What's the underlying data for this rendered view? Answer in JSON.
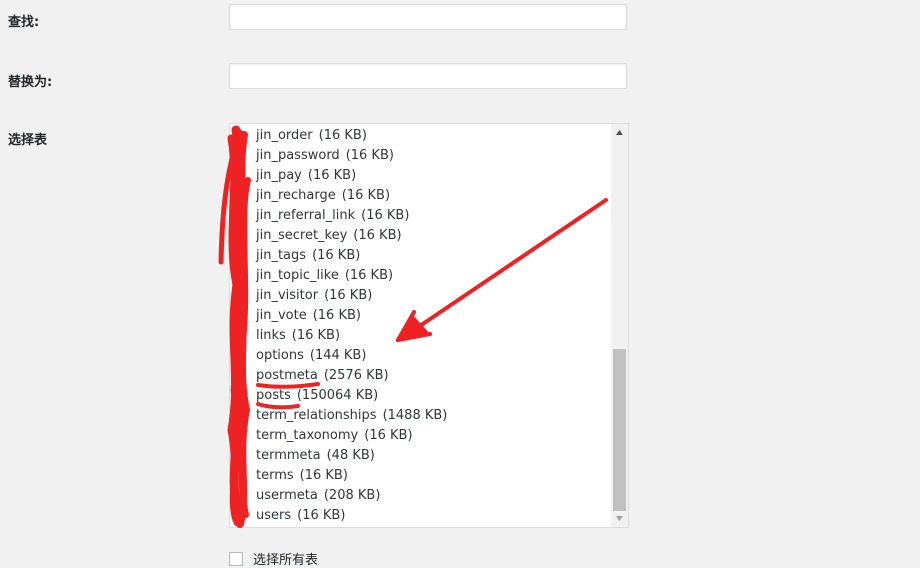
{
  "form": {
    "find_label": "查找:",
    "find_value": "",
    "replace_label": "替换为:",
    "replace_value": "",
    "select_table_label": "选择表",
    "select_all_label": "选择所有表"
  },
  "tables": [
    {
      "name": "jin_order",
      "size": "(16 KB)"
    },
    {
      "name": "jin_password",
      "size": "(16 KB)"
    },
    {
      "name": "jin_pay",
      "size": "(16 KB)"
    },
    {
      "name": "jin_recharge",
      "size": "(16 KB)"
    },
    {
      "name": "jin_referral_link",
      "size": "(16 KB)"
    },
    {
      "name": "jin_secret_key",
      "size": "(16 KB)"
    },
    {
      "name": "jin_tags",
      "size": "(16 KB)"
    },
    {
      "name": "jin_topic_like",
      "size": "(16 KB)"
    },
    {
      "name": "jin_visitor",
      "size": "(16 KB)"
    },
    {
      "name": "jin_vote",
      "size": "(16 KB)"
    },
    {
      "name": "links",
      "size": "(16 KB)"
    },
    {
      "name": "options",
      "size": "(144 KB)"
    },
    {
      "name": "postmeta",
      "size": "(2576 KB)"
    },
    {
      "name": "posts",
      "size": "(150064 KB)"
    },
    {
      "name": "term_relationships",
      "size": "(1488 KB)"
    },
    {
      "name": "term_taxonomy",
      "size": "(16 KB)"
    },
    {
      "name": "termmeta",
      "size": "(48 KB)"
    },
    {
      "name": "terms",
      "size": "(16 KB)"
    },
    {
      "name": "usermeta",
      "size": "(208 KB)"
    },
    {
      "name": "users",
      "size": "(16 KB)"
    }
  ],
  "colors": {
    "annotation": "#ee2222"
  }
}
